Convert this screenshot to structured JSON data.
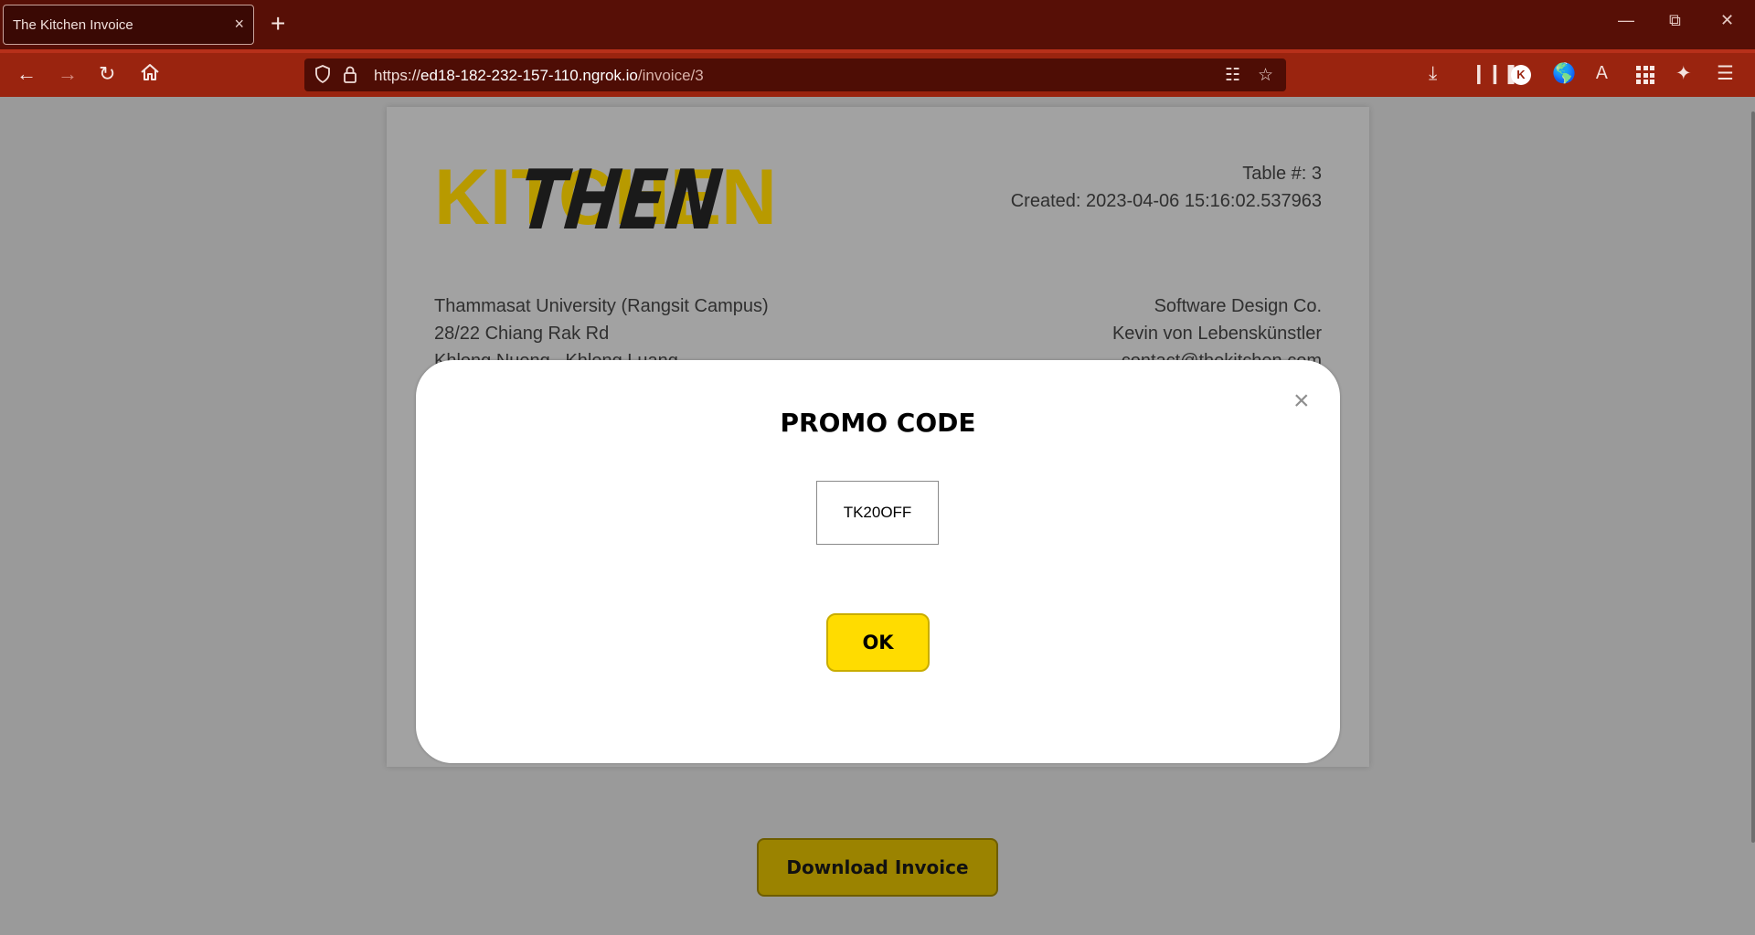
{
  "browser": {
    "tab_title": "The Kitchen Invoice",
    "tab_close": "×",
    "new_tab": "+",
    "url_prefix": "https://",
    "url_host": "ed18-182-232-157-110.ngrok.io",
    "url_path": "/invoice/3",
    "window_controls": [
      "minimize-icon",
      "restore-icon",
      "close-icon"
    ],
    "toolbar_icons": [
      "downloads-icon",
      "library-icon",
      "account-icon",
      "extension-icon",
      "translate-icon",
      "apps-grid-icon",
      "extensions-icon",
      "menu-icon"
    ],
    "account_initial": "K"
  },
  "invoice": {
    "logo_text": "KITCHEN",
    "table_label": "Table #: 3",
    "created_label": "Created: 2023-04-06 15:16:02.537963",
    "address_left": [
      "Thammasat University (Rangsit Campus)",
      "28/22 Chiang Rak Rd",
      "Khlong Nueng , Khlong Luang"
    ],
    "address_right": [
      "Software Design Co.",
      "Kevin von Lebenskünstler",
      "contact@thekitchen.com"
    ],
    "download_label": "Download Invoice"
  },
  "modal": {
    "title": "PROMO CODE",
    "close": "×",
    "promo_value": "TK20OFF",
    "ok_label": "OK"
  },
  "colors": {
    "tab_bar": "#570f06",
    "nav_bar": "#9a240f",
    "overlay": "#9a9a9a",
    "ok_button": "#ffdc00",
    "download_button": "#9b8300",
    "logo_yellow": "#b89a00"
  }
}
